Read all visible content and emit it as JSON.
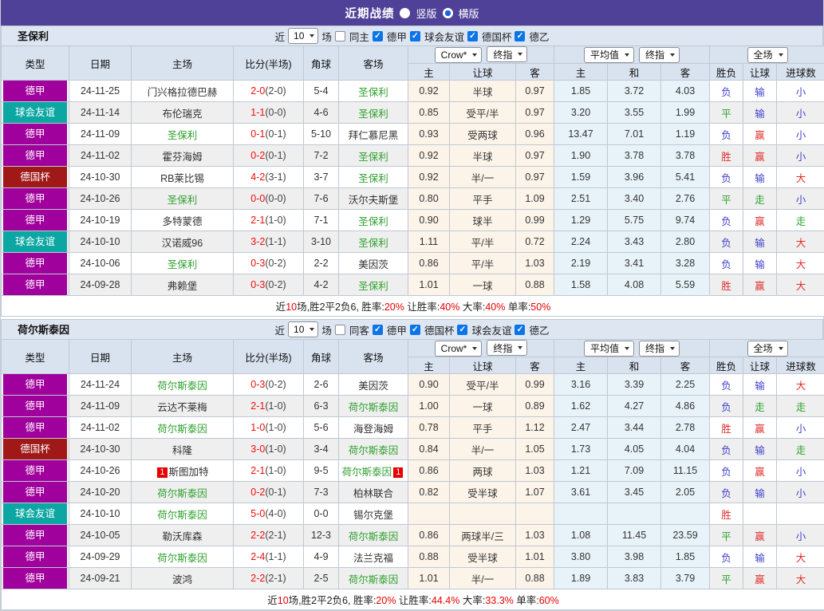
{
  "title_bar": {
    "title": "近期战绩",
    "vertical_label": "竖版",
    "horizontal_label": "横版",
    "vertical_checked": false,
    "horizontal_checked": true
  },
  "controls": {
    "near_label": "近",
    "games_value": "10",
    "games_unit": "场",
    "group1_select": "Crow*",
    "group1_final": "终指",
    "group2_select": "平均值",
    "group2_final": "终指",
    "group3_select": "全场"
  },
  "columns": {
    "type": "类型",
    "date": "日期",
    "home": "主场",
    "score": "比分(半场)",
    "corner": "角球",
    "away": "客场",
    "g1": [
      "主",
      "让球",
      "客"
    ],
    "g2": [
      "主",
      "和",
      "客"
    ],
    "g3": [
      "胜负",
      "让球",
      "进球数"
    ]
  },
  "colors": {
    "topbar": "#4E4197",
    "league_dejia": "#A0009B",
    "league_friendly": "#0CA7A3",
    "league_cup": "#A01818",
    "self_team": "#2FA02F",
    "score_red": "#F20D0D",
    "result_red": "#E12E2E",
    "result_green": "#2BA32B",
    "result_blue": "#4040CF",
    "crow_col_bg": "#FCF4E9",
    "avg_col_bg": "#E8F3F9"
  },
  "tables": [
    {
      "team": "圣保利",
      "same_filter": {
        "label": "同主",
        "checked": false
      },
      "leagues": [
        {
          "label": "德甲",
          "checked": true
        },
        {
          "label": "球会友谊",
          "checked": true
        },
        {
          "label": "德国杯",
          "checked": true
        },
        {
          "label": "德乙",
          "checked": true
        }
      ],
      "rows": [
        {
          "type": "德甲",
          "tc": "purple",
          "date": "24-11-25",
          "home": "门兴格拉德巴赫",
          "home_self": false,
          "home_badge": "",
          "score": "2-0",
          "half": "(2-0)",
          "corner": "5-4",
          "away": "圣保利",
          "away_self": true,
          "away_badge": "",
          "odds": [
            "0.92",
            "半球",
            "0.97"
          ],
          "avg": [
            "1.85",
            "3.72",
            "4.03"
          ],
          "res": [
            [
              "负",
              "b"
            ],
            [
              "输",
              "b"
            ],
            [
              "小",
              "b"
            ]
          ]
        },
        {
          "type": "球会友谊",
          "tc": "teal",
          "date": "24-11-14",
          "home": "布伦瑞克",
          "home_self": false,
          "home_badge": "",
          "score": "1-1",
          "half": "(0-0)",
          "corner": "4-6",
          "away": "圣保利",
          "away_self": true,
          "away_badge": "",
          "odds": [
            "0.85",
            "受平/半",
            "0.97"
          ],
          "avg": [
            "3.20",
            "3.55",
            "1.99"
          ],
          "res": [
            [
              "平",
              "g"
            ],
            [
              "输",
              "b"
            ],
            [
              "小",
              "b"
            ]
          ]
        },
        {
          "type": "德甲",
          "tc": "purple",
          "date": "24-11-09",
          "home": "圣保利",
          "home_self": true,
          "home_badge": "",
          "score": "0-1",
          "half": "(0-1)",
          "corner": "5-10",
          "away": "拜仁慕尼黑",
          "away_self": false,
          "away_badge": "",
          "odds": [
            "0.93",
            "受两球",
            "0.96"
          ],
          "avg": [
            "13.47",
            "7.01",
            "1.19"
          ],
          "res": [
            [
              "负",
              "b"
            ],
            [
              "赢",
              "r"
            ],
            [
              "小",
              "b"
            ]
          ]
        },
        {
          "type": "德甲",
          "tc": "purple",
          "date": "24-11-02",
          "home": "霍芬海姆",
          "home_self": false,
          "home_badge": "",
          "score": "0-2",
          "half": "(0-1)",
          "corner": "7-2",
          "away": "圣保利",
          "away_self": true,
          "away_badge": "",
          "odds": [
            "0.92",
            "半球",
            "0.97"
          ],
          "avg": [
            "1.90",
            "3.78",
            "3.78"
          ],
          "res": [
            [
              "胜",
              "r"
            ],
            [
              "赢",
              "r"
            ],
            [
              "小",
              "b"
            ]
          ]
        },
        {
          "type": "德国杯",
          "tc": "red",
          "date": "24-10-30",
          "home": "RB莱比锡",
          "home_self": false,
          "home_badge": "",
          "score": "4-2",
          "half": "(3-1)",
          "corner": "3-7",
          "away": "圣保利",
          "away_self": true,
          "away_badge": "",
          "odds": [
            "0.92",
            "半/一",
            "0.97"
          ],
          "avg": [
            "1.59",
            "3.96",
            "5.41"
          ],
          "res": [
            [
              "负",
              "b"
            ],
            [
              "输",
              "b"
            ],
            [
              "大",
              "r"
            ]
          ]
        },
        {
          "type": "德甲",
          "tc": "purple",
          "date": "24-10-26",
          "home": "圣保利",
          "home_self": true,
          "home_badge": "",
          "score": "0-0",
          "half": "(0-0)",
          "corner": "7-6",
          "away": "沃尔夫斯堡",
          "away_self": false,
          "away_badge": "",
          "odds": [
            "0.80",
            "平手",
            "1.09"
          ],
          "avg": [
            "2.51",
            "3.40",
            "2.76"
          ],
          "res": [
            [
              "平",
              "g"
            ],
            [
              "走",
              "g"
            ],
            [
              "小",
              "b"
            ]
          ]
        },
        {
          "type": "德甲",
          "tc": "purple",
          "date": "24-10-19",
          "home": "多特蒙德",
          "home_self": false,
          "home_badge": "",
          "score": "2-1",
          "half": "(1-0)",
          "corner": "7-1",
          "away": "圣保利",
          "away_self": true,
          "away_badge": "",
          "odds": [
            "0.90",
            "球半",
            "0.99"
          ],
          "avg": [
            "1.29",
            "5.75",
            "9.74"
          ],
          "res": [
            [
              "负",
              "b"
            ],
            [
              "赢",
              "r"
            ],
            [
              "走",
              "g"
            ]
          ]
        },
        {
          "type": "球会友谊",
          "tc": "teal",
          "date": "24-10-10",
          "home": "汉诺威96",
          "home_self": false,
          "home_badge": "",
          "score": "3-2",
          "half": "(1-1)",
          "corner": "3-10",
          "away": "圣保利",
          "away_self": true,
          "away_badge": "",
          "odds": [
            "1.11",
            "平/半",
            "0.72"
          ],
          "avg": [
            "2.24",
            "3.43",
            "2.80"
          ],
          "res": [
            [
              "负",
              "b"
            ],
            [
              "输",
              "b"
            ],
            [
              "大",
              "r"
            ]
          ]
        },
        {
          "type": "德甲",
          "tc": "purple",
          "date": "24-10-06",
          "home": "圣保利",
          "home_self": true,
          "home_badge": "",
          "score": "0-3",
          "half": "(0-2)",
          "corner": "2-2",
          "away": "美因茨",
          "away_self": false,
          "away_badge": "",
          "odds": [
            "0.86",
            "平/半",
            "1.03"
          ],
          "avg": [
            "2.19",
            "3.41",
            "3.28"
          ],
          "res": [
            [
              "负",
              "b"
            ],
            [
              "输",
              "b"
            ],
            [
              "大",
              "r"
            ]
          ]
        },
        {
          "type": "德甲",
          "tc": "purple",
          "date": "24-09-28",
          "home": "弗赖堡",
          "home_self": false,
          "home_badge": "",
          "score": "0-3",
          "half": "(0-2)",
          "corner": "4-2",
          "away": "圣保利",
          "away_self": true,
          "away_badge": "",
          "odds": [
            "1.01",
            "一球",
            "0.88"
          ],
          "avg": [
            "1.58",
            "4.08",
            "5.59"
          ],
          "res": [
            [
              "胜",
              "r"
            ],
            [
              "赢",
              "r"
            ],
            [
              "大",
              "r"
            ]
          ]
        }
      ],
      "summary": [
        [
          "近",
          0
        ],
        [
          "10",
          1
        ],
        [
          "场,胜2平2负6, 胜率:",
          0
        ],
        [
          "20%",
          1
        ],
        [
          " 让胜率:",
          0
        ],
        [
          "40%",
          1
        ],
        [
          " 大率:",
          0
        ],
        [
          "40%",
          1
        ],
        [
          " 单率:",
          0
        ],
        [
          "50%",
          1
        ]
      ]
    },
    {
      "team": "荷尔斯泰因",
      "same_filter": {
        "label": "同客",
        "checked": false
      },
      "leagues": [
        {
          "label": "德甲",
          "checked": true
        },
        {
          "label": "德国杯",
          "checked": true
        },
        {
          "label": "球会友谊",
          "checked": true
        },
        {
          "label": "德乙",
          "checked": true
        }
      ],
      "rows": [
        {
          "type": "德甲",
          "tc": "purple",
          "date": "24-11-24",
          "home": "荷尔斯泰因",
          "home_self": true,
          "home_badge": "",
          "score": "0-3",
          "half": "(0-2)",
          "corner": "2-6",
          "away": "美因茨",
          "away_self": false,
          "away_badge": "",
          "odds": [
            "0.90",
            "受平/半",
            "0.99"
          ],
          "avg": [
            "3.16",
            "3.39",
            "2.25"
          ],
          "res": [
            [
              "负",
              "b"
            ],
            [
              "输",
              "b"
            ],
            [
              "大",
              "r"
            ]
          ]
        },
        {
          "type": "德甲",
          "tc": "purple",
          "date": "24-11-09",
          "home": "云达不莱梅",
          "home_self": false,
          "home_badge": "",
          "score": "2-1",
          "half": "(1-0)",
          "corner": "6-3",
          "away": "荷尔斯泰因",
          "away_self": true,
          "away_badge": "",
          "odds": [
            "1.00",
            "一球",
            "0.89"
          ],
          "avg": [
            "1.62",
            "4.27",
            "4.86"
          ],
          "res": [
            [
              "负",
              "b"
            ],
            [
              "走",
              "g"
            ],
            [
              "走",
              "g"
            ]
          ]
        },
        {
          "type": "德甲",
          "tc": "purple",
          "date": "24-11-02",
          "home": "荷尔斯泰因",
          "home_self": true,
          "home_badge": "",
          "score": "1-0",
          "half": "(1-0)",
          "corner": "5-6",
          "away": "海登海姆",
          "away_self": false,
          "away_badge": "",
          "odds": [
            "0.78",
            "平手",
            "1.12"
          ],
          "avg": [
            "2.47",
            "3.44",
            "2.78"
          ],
          "res": [
            [
              "胜",
              "r"
            ],
            [
              "赢",
              "r"
            ],
            [
              "小",
              "b"
            ]
          ]
        },
        {
          "type": "德国杯",
          "tc": "red",
          "date": "24-10-30",
          "home": "科隆",
          "home_self": false,
          "home_badge": "",
          "score": "3-0",
          "half": "(1-0)",
          "corner": "3-4",
          "away": "荷尔斯泰因",
          "away_self": true,
          "away_badge": "",
          "odds": [
            "0.84",
            "半/一",
            "1.05"
          ],
          "avg": [
            "1.73",
            "4.05",
            "4.04"
          ],
          "res": [
            [
              "负",
              "b"
            ],
            [
              "输",
              "b"
            ],
            [
              "走",
              "g"
            ]
          ]
        },
        {
          "type": "德甲",
          "tc": "purple",
          "date": "24-10-26",
          "home": "斯图加特",
          "home_self": false,
          "home_badge": "1",
          "score": "2-1",
          "half": "(1-0)",
          "corner": "9-5",
          "away": "荷尔斯泰因",
          "away_self": true,
          "away_badge": "1",
          "odds": [
            "0.86",
            "两球",
            "1.03"
          ],
          "avg": [
            "1.21",
            "7.09",
            "11.15"
          ],
          "res": [
            [
              "负",
              "b"
            ],
            [
              "赢",
              "r"
            ],
            [
              "小",
              "b"
            ]
          ]
        },
        {
          "type": "德甲",
          "tc": "purple",
          "date": "24-10-20",
          "home": "荷尔斯泰因",
          "home_self": true,
          "home_badge": "",
          "score": "0-2",
          "half": "(0-1)",
          "corner": "7-3",
          "away": "柏林联合",
          "away_self": false,
          "away_badge": "",
          "odds": [
            "0.82",
            "受半球",
            "1.07"
          ],
          "avg": [
            "3.61",
            "3.45",
            "2.05"
          ],
          "res": [
            [
              "负",
              "b"
            ],
            [
              "输",
              "b"
            ],
            [
              "小",
              "b"
            ]
          ]
        },
        {
          "type": "球会友谊",
          "tc": "teal",
          "date": "24-10-10",
          "home": "荷尔斯泰因",
          "home_self": true,
          "home_badge": "",
          "score": "5-0",
          "half": "(4-0)",
          "corner": "0-0",
          "away": "锡尔克堡",
          "away_self": false,
          "away_badge": "",
          "odds": [
            "",
            "",
            ""
          ],
          "avg": [
            "",
            "",
            ""
          ],
          "res": [
            [
              "胜",
              "r"
            ],
            [
              "",
              ""
            ],
            [
              "",
              ""
            ]
          ]
        },
        {
          "type": "德甲",
          "tc": "purple",
          "date": "24-10-05",
          "home": "勒沃库森",
          "home_self": false,
          "home_badge": "",
          "score": "2-2",
          "half": "(2-1)",
          "corner": "12-3",
          "away": "荷尔斯泰因",
          "away_self": true,
          "away_badge": "",
          "odds": [
            "0.86",
            "两球半/三",
            "1.03"
          ],
          "avg": [
            "1.08",
            "11.45",
            "23.59"
          ],
          "res": [
            [
              "平",
              "g"
            ],
            [
              "赢",
              "r"
            ],
            [
              "小",
              "b"
            ]
          ]
        },
        {
          "type": "德甲",
          "tc": "purple",
          "date": "24-09-29",
          "home": "荷尔斯泰因",
          "home_self": true,
          "home_badge": "",
          "score": "2-4",
          "half": "(1-1)",
          "corner": "4-9",
          "away": "法兰克福",
          "away_self": false,
          "away_badge": "",
          "odds": [
            "0.88",
            "受半球",
            "1.01"
          ],
          "avg": [
            "3.80",
            "3.98",
            "1.85"
          ],
          "res": [
            [
              "负",
              "b"
            ],
            [
              "输",
              "b"
            ],
            [
              "大",
              "r"
            ]
          ]
        },
        {
          "type": "德甲",
          "tc": "purple",
          "date": "24-09-21",
          "home": "波鸿",
          "home_self": false,
          "home_badge": "",
          "score": "2-2",
          "half": "(2-1)",
          "corner": "2-5",
          "away": "荷尔斯泰因",
          "away_self": true,
          "away_badge": "",
          "odds": [
            "1.01",
            "半/一",
            "0.88"
          ],
          "avg": [
            "1.89",
            "3.83",
            "3.79"
          ],
          "res": [
            [
              "平",
              "g"
            ],
            [
              "赢",
              "r"
            ],
            [
              "大",
              "r"
            ]
          ]
        }
      ],
      "summary": [
        [
          "近",
          0
        ],
        [
          "10",
          1
        ],
        [
          "场,胜2平2负6, 胜率:",
          0
        ],
        [
          "20%",
          1
        ],
        [
          " 让胜率:",
          0
        ],
        [
          "44.4%",
          1
        ],
        [
          " 大率:",
          0
        ],
        [
          "33.3%",
          1
        ],
        [
          " 单率:",
          0
        ],
        [
          "60%",
          1
        ]
      ]
    }
  ]
}
